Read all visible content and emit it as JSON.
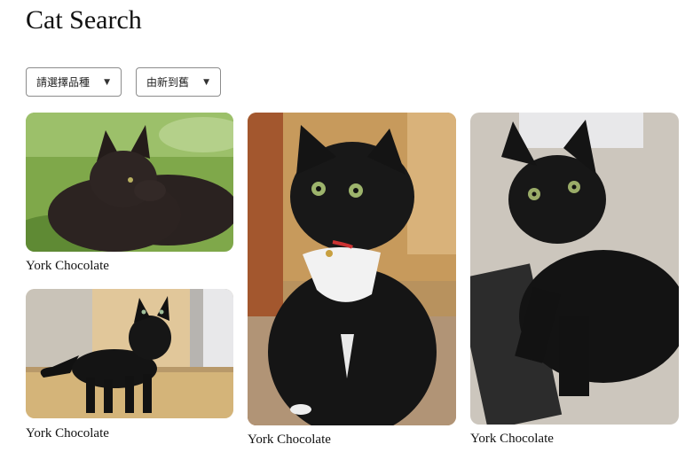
{
  "header": {
    "title": "Cat Search"
  },
  "filters": {
    "breed_select": {
      "selected": "請選擇品種",
      "icon": "caret-down-icon"
    },
    "sort_select": {
      "selected": "由新到舊",
      "icon": "caret-down-icon"
    }
  },
  "results": [
    {
      "breed": "York Chocolate"
    },
    {
      "breed": "York Chocolate"
    },
    {
      "breed": "York Chocolate"
    },
    {
      "breed": "York Chocolate"
    }
  ]
}
